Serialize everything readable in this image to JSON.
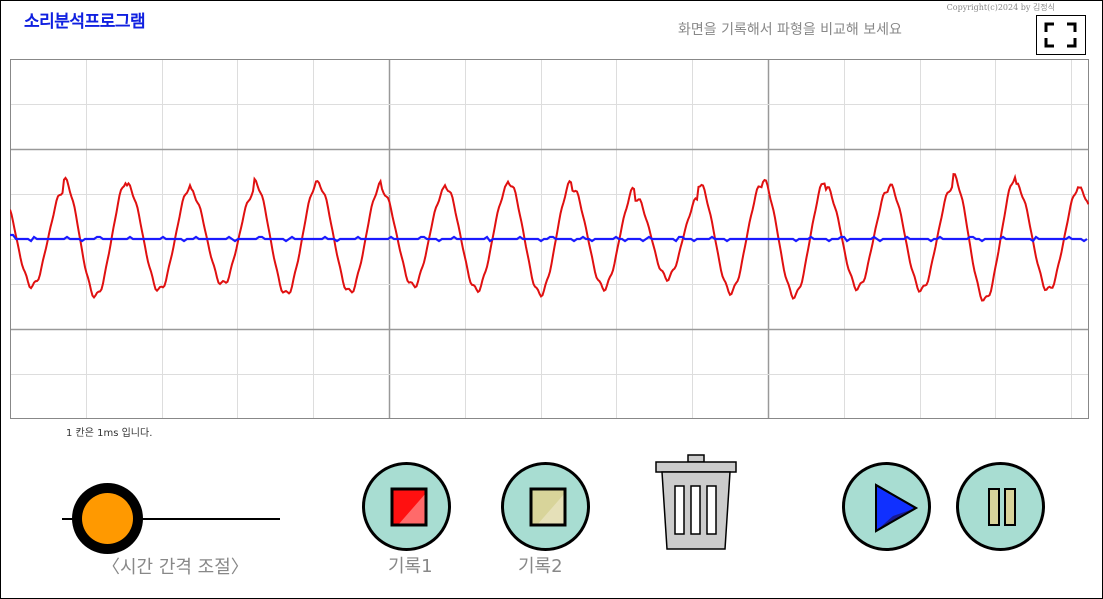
{
  "header": {
    "title": "소리분석프로그램",
    "copyright": "Copyright(c)2024 by 김정식",
    "hint": "화면을 기록해서 파형을 비교해 보세요",
    "fullscreen_icon": "fullscreen-icon"
  },
  "scope": {
    "scale_note": "1 칸은 1ms 입니다.",
    "grid_color": "#dddddd",
    "major_grid_color": "#999999",
    "live_wave_color": "#1a1aff",
    "record_wave_color": "#e01010"
  },
  "controls": {
    "time_slider_label": "〈시간 간격 조절〉",
    "record1_label": "기록1",
    "record2_label": "기록2",
    "trash_icon": "trash-icon",
    "play_icon": "play-icon",
    "pause_icon": "pause-icon",
    "accent_color": "#a8ddd2",
    "knob_color": "#ff9900"
  }
}
